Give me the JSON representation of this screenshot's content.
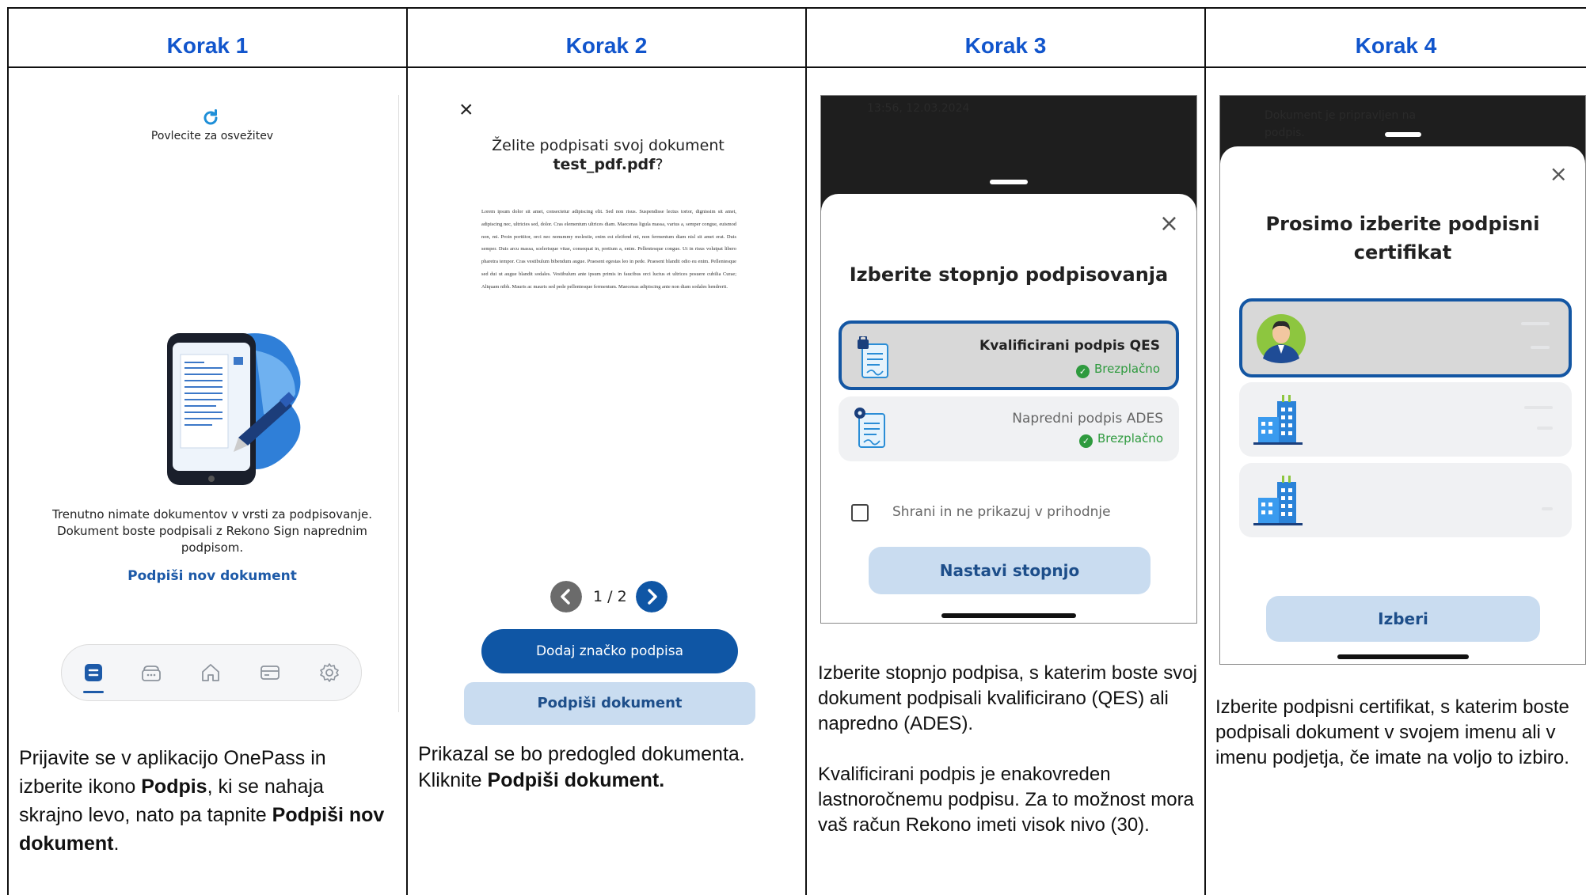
{
  "columns": [
    {
      "heading": "Korak 1"
    },
    {
      "heading": "Korak 2"
    },
    {
      "heading": "Korak 3"
    },
    {
      "heading": "Korak 4"
    }
  ],
  "step1": {
    "pull_text": "Povlecite za osvežitev",
    "empty_text": "Trenutno nimate dokumentov v vrsti za podpisovanje. Dokument boste podpisali z Rekono Sign naprednim podpisom.",
    "link_new": "Podpiši nov dokument",
    "nav_items": [
      "documents-icon",
      "wallet-icon",
      "home-icon",
      "card-icon",
      "gear-icon"
    ],
    "caption": {
      "p1": "Prijavite se v aplikacijo OnePass in izberite ikono ",
      "b1": "Podpis",
      "p2": ", ki se nahaja skrajno levo, nato pa tapnite ",
      "b2": "Podpiši nov dokument",
      "p3": "."
    }
  },
  "step2": {
    "close": "×",
    "title_line1": "Želite podpisati svoj dokument",
    "filename": "test_pdf.pdf",
    "title_suffix": "?",
    "doc_text": "Lorem ipsum dolor sit amet, consectetur adipiscing elit. Sed non risus. Suspendisse lectus tortor, dignissim sit amet, adipiscing nec, ultricies sed, dolor. Cras elementum ultrices diam. Maecenas ligula massa, varius a, semper congue, euismod non, mi. Proin porttitor, orci nec nonummy molestie, enim est eleifend mi, non fermentum diam nisl sit amet erat. Duis semper. Duis arcu massa, scelerisque vitae, consequat in, pretium a, enim. Pellentesque congue. Ut in risus volutpat libero pharetra tempor. Cras vestibulum bibendum augue. Praesent egestas leo in pede. Praesent blandit odio eu enim. Pellentesque sed dui ut augue blandit sodales. Vestibulum ante ipsum primis in faucibus orci luctus et ultrices posuere cubilia Curae; Aliquam nibh. Mauris ac mauris sed pede pellentesque fermentum. Maecenas adipiscing ante non diam sodales hendrerit.",
    "page_indicator": "1 / 2",
    "btn_add_stamp": "Dodaj značko podpisa",
    "btn_sign": "Podpiši dokument",
    "caption": {
      "p1": "Prikazal se bo predogled dokumenta. Kliknite ",
      "b1": "Podpiši dokument."
    }
  },
  "step3": {
    "status_time": "13:56, 12.03.2024",
    "close": "×",
    "title": "Izberite stopnjo podpisovanja",
    "options": [
      {
        "label": "Kvalificirani podpis QES",
        "badge": "Brezplačno",
        "selected": true
      },
      {
        "label": "Napredni podpis ADES",
        "badge": "Brezplačno",
        "selected": false
      }
    ],
    "checkbox_label": "Shrani in ne prikazuj v prihodnje",
    "btn_continue": "Nastavi stopnjo",
    "caption_p1": "Izberite stopnjo podpisa, s katerim boste svoj dokument podpisali kvalificirano (QES) ali napredno (ADES).",
    "caption_p2": "Kvalificirani podpis je enakovreden lastnoročnemu podpisu. Za to možnost mora vaš račun Rekono imeti visok nivo (30)."
  },
  "step4": {
    "behind_text": "Dokument je pripravljen na podpis.",
    "close": "×",
    "title": "Prosimo izberite podpisni certifikat",
    "certs": [
      {
        "type": "person",
        "icon": "person-avatar-icon",
        "selected": true
      },
      {
        "type": "company",
        "icon": "company-building-icon",
        "selected": false
      },
      {
        "type": "company",
        "icon": "company-building-icon",
        "selected": false
      }
    ],
    "btn_choose": "Izberi",
    "caption": "Izberite podpisni certifikat, s katerim boste podpisali dokument v svojem imenu ali v imenu podjetja, če imate na voljo to izbiro."
  },
  "colors": {
    "heading_blue": "#1155cc",
    "primary_button": "#0f56a5",
    "secondary_button": "#c9dcf0",
    "selected_border": "#1356a3",
    "badge_green": "#2e9a3e"
  }
}
